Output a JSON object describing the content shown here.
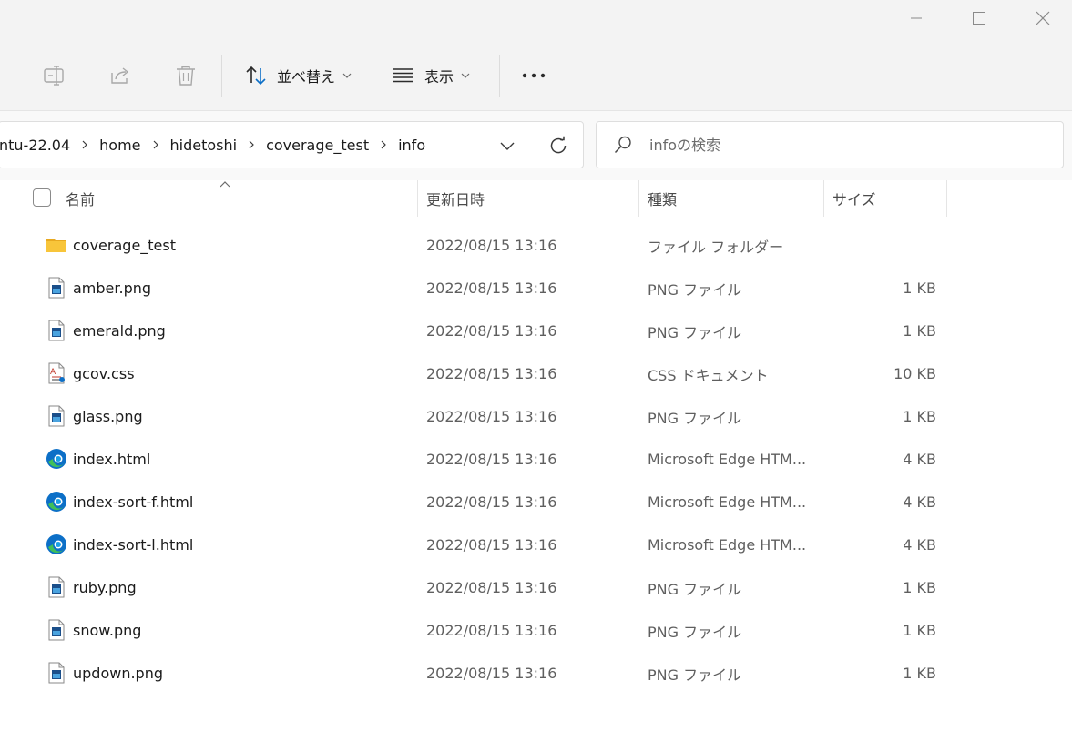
{
  "toolbar": {
    "sort_label": "並べ替え",
    "view_label": "表示"
  },
  "address": {
    "crumbs": [
      "ntu-22.04",
      "home",
      "hidetoshi",
      "coverage_test",
      "info"
    ]
  },
  "search": {
    "placeholder": "infoの検索"
  },
  "columns": {
    "name": "名前",
    "date": "更新日時",
    "type": "種類",
    "size": "サイズ"
  },
  "files": [
    {
      "name": "coverage_test",
      "date": "2022/08/15 13:16",
      "type": "ファイル フォルダー",
      "size": "",
      "icon": "folder-icon"
    },
    {
      "name": "amber.png",
      "date": "2022/08/15 13:16",
      "type": "PNG ファイル",
      "size": "1 KB",
      "icon": "png-file-icon"
    },
    {
      "name": "emerald.png",
      "date": "2022/08/15 13:16",
      "type": "PNG ファイル",
      "size": "1 KB",
      "icon": "png-file-icon"
    },
    {
      "name": "gcov.css",
      "date": "2022/08/15 13:16",
      "type": "CSS ドキュメント",
      "size": "10 KB",
      "icon": "css-file-icon"
    },
    {
      "name": "glass.png",
      "date": "2022/08/15 13:16",
      "type": "PNG ファイル",
      "size": "1 KB",
      "icon": "png-file-icon"
    },
    {
      "name": "index.html",
      "date": "2022/08/15 13:16",
      "type": "Microsoft Edge HTM...",
      "size": "4 KB",
      "icon": "edge-icon"
    },
    {
      "name": "index-sort-f.html",
      "date": "2022/08/15 13:16",
      "type": "Microsoft Edge HTM...",
      "size": "4 KB",
      "icon": "edge-icon"
    },
    {
      "name": "index-sort-l.html",
      "date": "2022/08/15 13:16",
      "type": "Microsoft Edge HTM...",
      "size": "4 KB",
      "icon": "edge-icon"
    },
    {
      "name": "ruby.png",
      "date": "2022/08/15 13:16",
      "type": "PNG ファイル",
      "size": "1 KB",
      "icon": "png-file-icon"
    },
    {
      "name": "snow.png",
      "date": "2022/08/15 13:16",
      "type": "PNG ファイル",
      "size": "1 KB",
      "icon": "png-file-icon"
    },
    {
      "name": "updown.png",
      "date": "2022/08/15 13:16",
      "type": "PNG ファイル",
      "size": "1 KB",
      "icon": "png-file-icon"
    }
  ],
  "colors": {
    "chrome_bg": "#f3f3f3",
    "folder_yellow": "#f8c53a",
    "edge_blue": "#0c6fc7",
    "edge_green": "#3fbf5a"
  }
}
